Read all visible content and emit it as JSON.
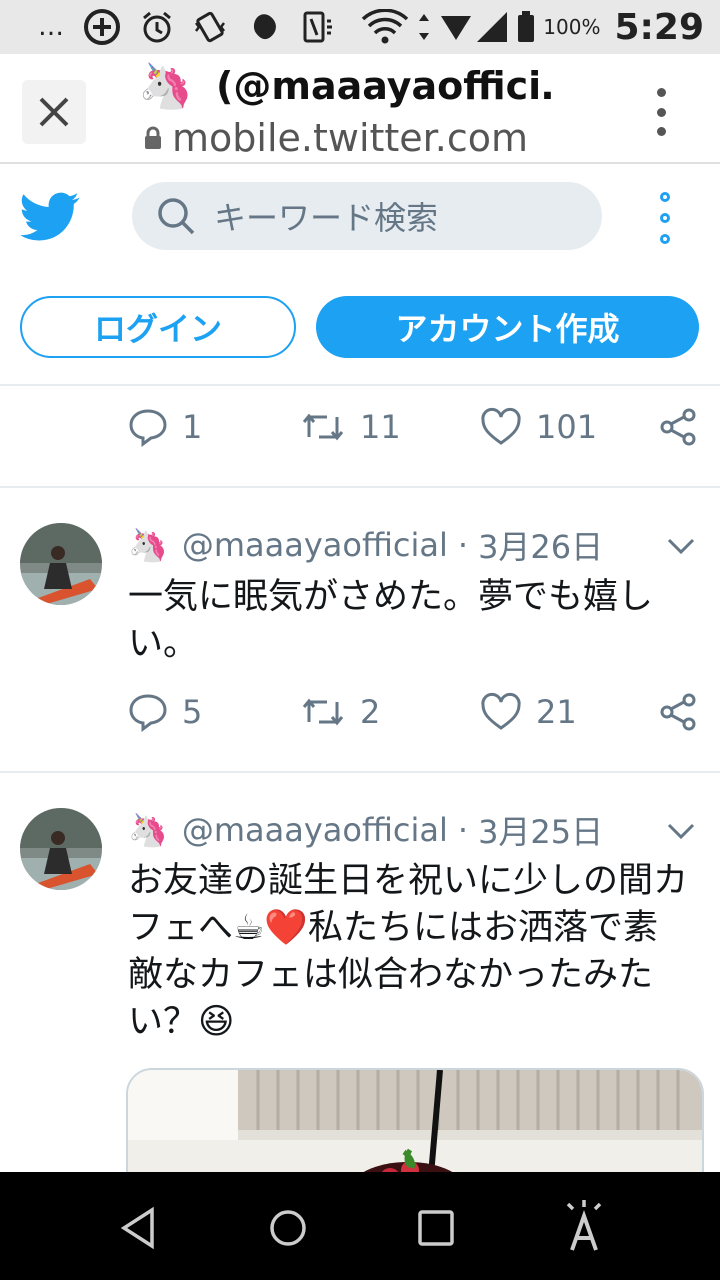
{
  "status_bar": {
    "dots": "…",
    "battery": "100%",
    "time": "5:29"
  },
  "browser": {
    "tab_emoji": "🦄",
    "title": "(@maaayaoffici…",
    "url": "mobile.twitter.com"
  },
  "twitter_header": {
    "search_placeholder": "キーワード検索",
    "login_label": "ログイン",
    "signup_label": "アカウント作成",
    "brand_color": "#1da1f2"
  },
  "prev_tweet_actions": {
    "replies": "1",
    "retweets": "11",
    "likes": "101"
  },
  "tweets": [
    {
      "emoji": "🦄",
      "handle": "@maaayaofficial",
      "separator": "·",
      "date": "3月26日",
      "text": "一気に眠気がさめた。夢でも嬉しい。",
      "replies": "5",
      "retweets": "2",
      "likes": "21"
    },
    {
      "emoji": "🦄",
      "handle": "@maaayaofficial",
      "separator": "·",
      "date": "3月25日",
      "text": "お友達の誕生日を祝いに少しの間カフェへ☕❤️私たちにはお洒落で素敵なカフェは似合わなかったみたい？😆"
    }
  ]
}
